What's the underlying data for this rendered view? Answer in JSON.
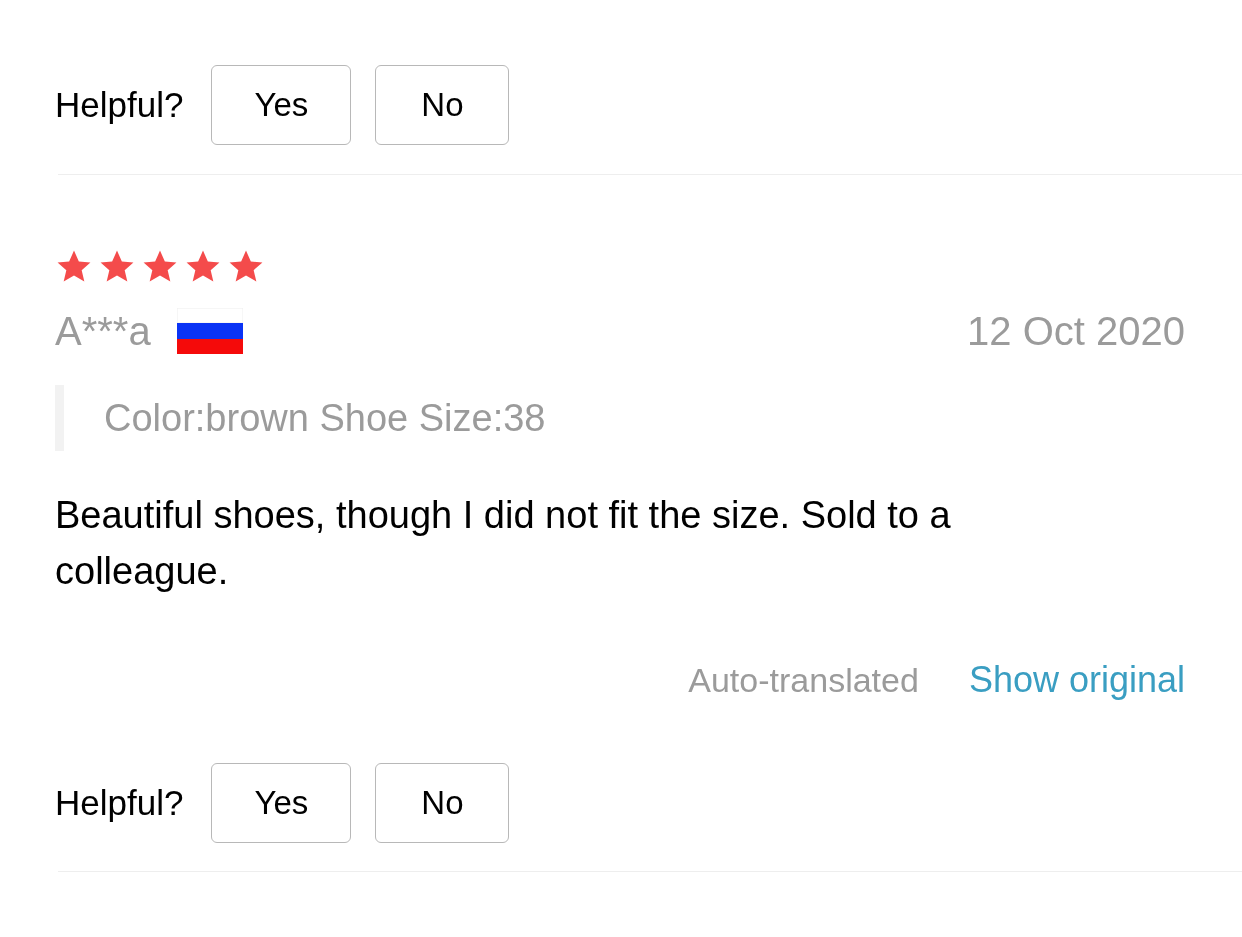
{
  "reviews": [
    {
      "helpful": {
        "label": "Helpful?",
        "yes": "Yes",
        "no": "No"
      }
    },
    {
      "stars": 5,
      "author": "A***a",
      "date": "12 Oct 2020",
      "sku": "Color:brown Shoe Size:38",
      "text": "Beautiful shoes, though I did not fit the size. Sold to a colleague.",
      "translated": "Auto-translated",
      "show_original": "Show original",
      "helpful": {
        "label": "Helpful?",
        "yes": "Yes",
        "no": "No"
      }
    }
  ]
}
